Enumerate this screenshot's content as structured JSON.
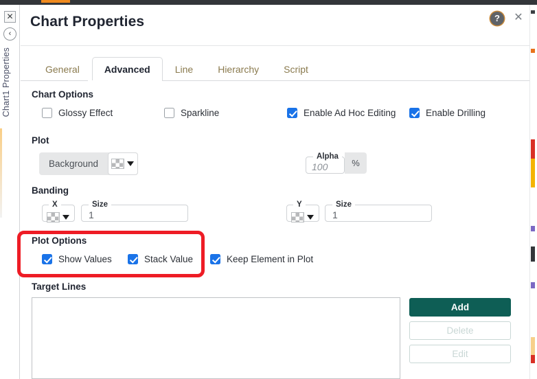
{
  "window": {
    "accent_orange": "#f08a1e",
    "topbar_color": "#33363a"
  },
  "rail": {
    "close_icon": "✕",
    "collapse_icon": "‹",
    "vertical_label": "Chart1 Properties"
  },
  "header": {
    "title": "Chart Properties",
    "help_icon": "?",
    "close_icon": "✕"
  },
  "tabs": [
    {
      "label": "General",
      "active": false
    },
    {
      "label": "Advanced",
      "active": true
    },
    {
      "label": "Line",
      "active": false
    },
    {
      "label": "Hierarchy",
      "active": false
    },
    {
      "label": "Script",
      "active": false
    }
  ],
  "chart_options": {
    "heading": "Chart Options",
    "items": [
      {
        "label": "Glossy Effect",
        "checked": false
      },
      {
        "label": "Sparkline",
        "checked": false
      },
      {
        "label": "Enable Ad Hoc Editing",
        "checked": true
      },
      {
        "label": "Enable Drilling",
        "checked": true
      }
    ]
  },
  "plot": {
    "heading": "Plot",
    "background_label": "Background",
    "background_swatch": "transparent-checker",
    "alpha_legend": "Alpha",
    "alpha_value": "100",
    "alpha_suffix": "%"
  },
  "banding": {
    "heading": "Banding",
    "x_legend": "X",
    "x_swatch": "transparent-checker",
    "x_size_legend": "Size",
    "x_size_value": "1",
    "y_legend": "Y",
    "y_swatch": "transparent-checker",
    "y_size_legend": "Size",
    "y_size_value": "1"
  },
  "plot_options": {
    "heading": "Plot Options",
    "items": [
      {
        "label": "Show Values",
        "checked": true
      },
      {
        "label": "Stack Value",
        "checked": true
      },
      {
        "label": "Keep Element in Plot",
        "checked": true
      }
    ],
    "highlight_color": "#ee1c25"
  },
  "target_lines": {
    "heading": "Target Lines",
    "list_items": [],
    "buttons": [
      {
        "label": "Add",
        "enabled": true
      },
      {
        "label": "Delete",
        "enabled": false
      },
      {
        "label": "Edit",
        "enabled": false
      }
    ],
    "primary_color": "#0e5e55"
  }
}
